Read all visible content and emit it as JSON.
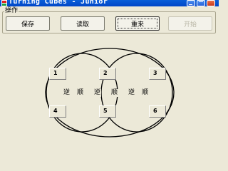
{
  "window": {
    "title": "Turning Cubes - Junior"
  },
  "group": {
    "label": "操作"
  },
  "buttons": {
    "save": "保存",
    "load": "读取",
    "reset": "重来",
    "start": "开始"
  },
  "tiles": [
    "1",
    "2",
    "3",
    "4",
    "5",
    "6"
  ],
  "rotations": [
    {
      "ccw": "逆",
      "cw": "顺"
    },
    {
      "ccw": "逆",
      "cw": "顺"
    },
    {
      "ccw": "逆",
      "cw": "顺"
    }
  ]
}
